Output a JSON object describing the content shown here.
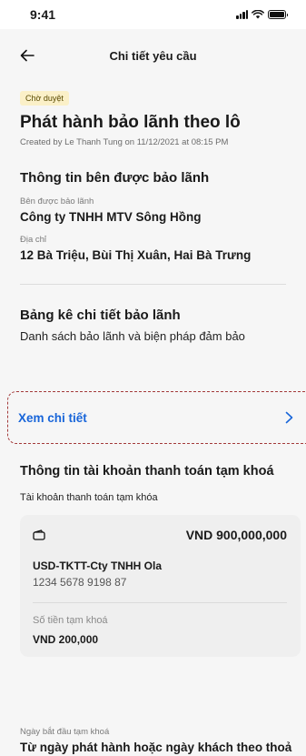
{
  "status": {
    "time": "9:41"
  },
  "header": {
    "title": "Chi tiết yêu cầu"
  },
  "request": {
    "badge": "Chờ duyệt",
    "title": "Phát hành bảo lãnh theo lô",
    "created_by": "Created by Le Thanh Tung on 11/12/2021 at 08:15 PM"
  },
  "beneficiary": {
    "section_title": "Thông tin bên được bảo lãnh",
    "name_label": "Bên được bảo lãnh",
    "name_value": "Công ty TNHH MTV Sông Hồng",
    "address_label": "Địa chỉ",
    "address_value": "12 Bà Triệu, Bùi Thị Xuân, Hai Bà Trưng"
  },
  "guarantee_list": {
    "title": "Bảng kê chi tiết bảo lãnh",
    "description": "Danh sách bảo lãnh và biện pháp đảm bảo",
    "view_details_label": "Xem chi tiết"
  },
  "account": {
    "section_title": "Thông tin tài khoản thanh toán tạm khoá",
    "subtitle": "Tài khoản thanh toán tạm khóa",
    "card": {
      "amount": "VND 900,000,000",
      "account_name": "USD-TKTT-Cty TNHH Ola",
      "account_number": "1234 5678 9198 87",
      "lock_amount_label": "Số tiền tạm khoá",
      "lock_amount_value": "VND 200,000"
    },
    "start_date_label": "Ngày bắt đầu tạm khoá",
    "start_date_value": "Từ ngày phát hành hoặc ngày khách theo thoả thuận với Techcombank"
  }
}
